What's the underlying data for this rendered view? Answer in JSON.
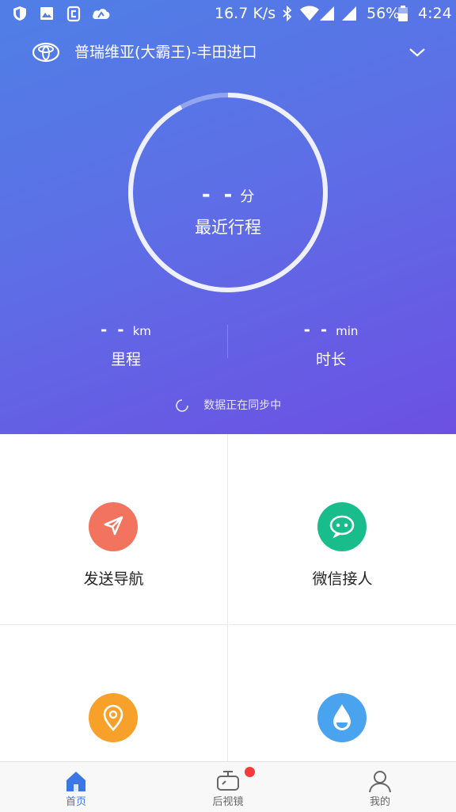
{
  "status_bar": {
    "speed": "16.7 K/s",
    "battery_percent": "56%",
    "time": "4:24",
    "icons": [
      "shield-icon",
      "image-icon",
      "app-icon",
      "cloud-icon",
      "bluetooth-icon",
      "wifi-icon",
      "signal-icon",
      "battery-icon"
    ]
  },
  "car": {
    "name": "普瑞维亚(大霸王)-丰田进口",
    "logo": "toyota-logo-icon",
    "dropdown_icon": "chevron-down-icon"
  },
  "trip": {
    "value": "- -",
    "unit": "分",
    "label": "最近行程",
    "ring_progress": 0.08
  },
  "stats": [
    {
      "value": "- -",
      "unit": "km",
      "label": "里程"
    },
    {
      "value": "- -",
      "unit": "min",
      "label": "时长"
    }
  ],
  "sync_text": "数据正在同步中",
  "features": [
    {
      "label": "发送导航",
      "icon": "send-navigation-icon",
      "color": "#f2745f"
    },
    {
      "label": "微信接人",
      "icon": "wechat-icon",
      "color": "#19bd8b"
    },
    {
      "label": "",
      "icon": "location-pin-icon",
      "color": "#f7a02a"
    },
    {
      "label": "",
      "icon": "water-drop-icon",
      "color": "#4aa3ee"
    }
  ],
  "tabs": [
    {
      "label": "首页",
      "icon": "home-icon",
      "active": true
    },
    {
      "label": "后视镜",
      "icon": "rearview-mirror-icon",
      "badge": true
    },
    {
      "label": "我的",
      "icon": "profile-icon"
    }
  ],
  "colors": {
    "hero_start": "#4f7fe6",
    "hero_end": "#6c50e3",
    "accent": "#3b76e4",
    "badge": "#f23b3b"
  }
}
